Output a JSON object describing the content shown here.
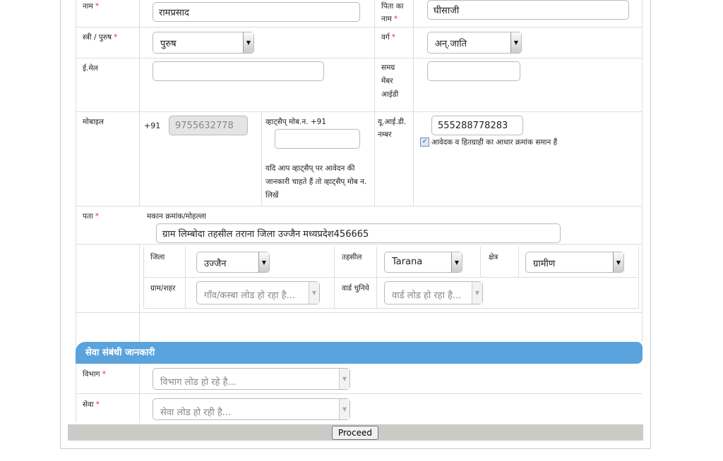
{
  "personal": {
    "name_label": "नाम",
    "name_value": "रामप्रसाद",
    "father_label": "पिता का नाम",
    "father_value": "घीसाजी",
    "gender_label": "स्त्री / पुरुष",
    "gender_value": "पुरुष",
    "category_label": "वर्ग",
    "category_value": "अन्.जाति",
    "email_label": "ई.मेल",
    "email_value": "",
    "samagra_label": "समग्र मेंबर आईडी",
    "samagra_value": "",
    "mobile_label": "मोबाइल",
    "mobile_prefix": "+91",
    "mobile_value": "9755632778",
    "whatsapp_label": "व्हाट्सैप् मोब.न.  +91",
    "whatsapp_value": "",
    "whatsapp_help": "यदि आप व्हाट्सैप् पर आवेदन की जानकारी चाहते हैं तो व्हाट्सैप् मोब न. लिखें",
    "uid_label": "यू.आई.डी. नम्बर",
    "uid_value": "555288778283",
    "aadhaar_same_label": "आवेदक व हितग्राही का आधार क्रमांक समान हैं",
    "aadhaar_same_checked": true,
    "required_mark": "*"
  },
  "address": {
    "label": "पता",
    "house_label": "मकान क्रमांक/मोहल्ला",
    "house_value": "ग्राम लिम्बोदा तहसील तराना जिला उज्जैन मध्यप्रदेश456665",
    "district_label": "जिला",
    "district_value": "उज्जैन",
    "tehsil_label": "तहसील",
    "tehsil_value": "Tarana",
    "area_label": "क्षेत्र",
    "area_value": "ग्रामीण",
    "village_label": "ग्राम/शहर",
    "village_value": "गाँव/कस्बा लोड हो रहा है...",
    "ward_label": "वार्ड चुनिये",
    "ward_value": "वार्ड लोड हो रहा है..."
  },
  "service": {
    "header": "सेवा संबंधी जानकारी",
    "department_label": "विभाग",
    "department_value": "विभाग लोड हो रहे है...",
    "service_label": "सेवा",
    "service_value": "सेवा लोड हो रही है...",
    "accent": "#5ba3dc"
  },
  "footer": {
    "proceed_label": "Proceed"
  }
}
